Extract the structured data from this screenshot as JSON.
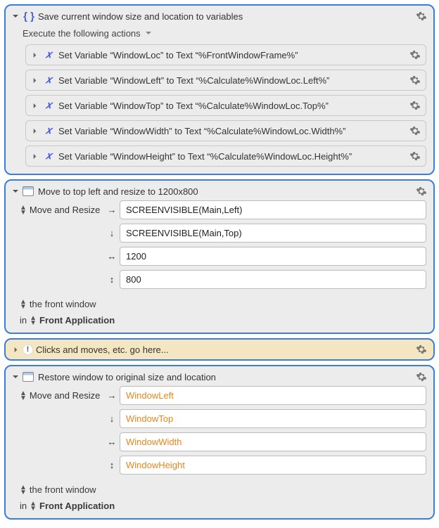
{
  "groups": {
    "save": {
      "title": "Save current window size and location to variables",
      "subheader": "Execute the following actions",
      "actions": [
        "Set Variable “WindowLoc” to Text “%FrontWindowFrame%”",
        "Set Variable “WindowLeft” to Text “%Calculate%WindowLoc.Left%”",
        "Set Variable “WindowTop” to Text “%Calculate%WindowLoc.Top%”",
        "Set Variable “WindowWidth” to Text “%Calculate%WindowLoc.Width%”",
        "Set Variable “WindowHeight” to Text “%Calculate%WindowLoc.Height%”"
      ]
    },
    "move1": {
      "title": "Move to top left and resize to 1200x800",
      "label": "Move and Resize",
      "rows": {
        "right": "SCREENVISIBLE(Main,Left)",
        "down": "SCREENVISIBLE(Main,Top)",
        "horiz": "1200",
        "vert": "800"
      },
      "target": "the front window",
      "in": "in",
      "app": "Front Application"
    },
    "note": {
      "title": "Clicks and moves, etc. go here..."
    },
    "restore": {
      "title": "Restore window to original size and location",
      "label": "Move and Resize",
      "rows": {
        "right": "WindowLeft",
        "down": "WindowTop",
        "horiz": "WindowWidth",
        "vert": "WindowHeight"
      },
      "target": "the front window",
      "in": "in",
      "app": "Front Application"
    }
  }
}
